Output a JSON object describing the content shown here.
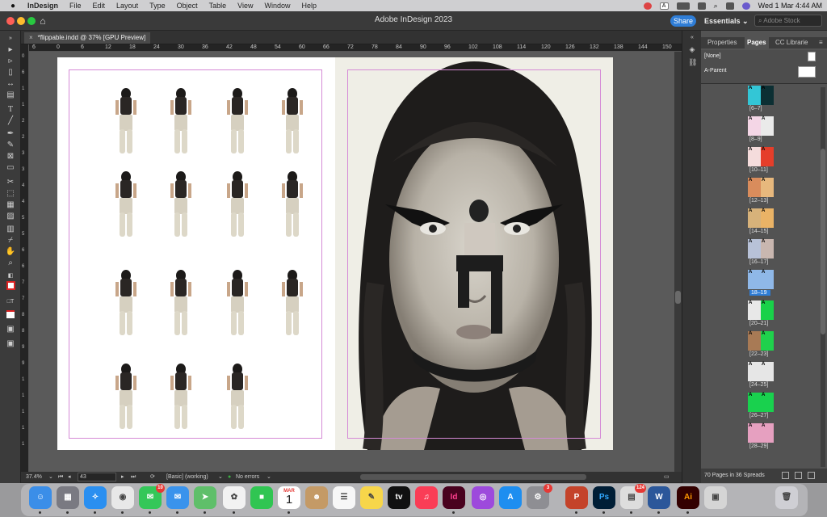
{
  "menubar": {
    "app_name": "InDesign",
    "items": [
      "File",
      "Edit",
      "Layout",
      "Type",
      "Object",
      "Table",
      "View",
      "Window",
      "Help"
    ],
    "datetime": "Wed 1 Mar  4:44 AM",
    "lang_badge": "A"
  },
  "titlebar": {
    "title": "Adobe InDesign 2023",
    "share_label": "Share",
    "workspace_label": "Essentials",
    "search_placeholder": "Adobe Stock"
  },
  "document": {
    "tab_label": "*flippable.indd @ 37% [GPU Preview]",
    "close_glyph": "×"
  },
  "ruler": {
    "h_ticks": [
      "6",
      "0",
      "6",
      "12",
      "18",
      "24",
      "30",
      "36",
      "42",
      "48",
      "54",
      "60",
      "66",
      "72",
      "78",
      "84",
      "90",
      "96",
      "102",
      "108",
      "114",
      "120",
      "126",
      "132",
      "138",
      "144",
      "150"
    ],
    "v_ticks": [
      "0",
      "6",
      "1",
      "1",
      "2",
      "2",
      "3",
      "3",
      "4",
      "4",
      "5",
      "5",
      "6",
      "6",
      "7",
      "7",
      "8",
      "8",
      "9",
      "9",
      "1",
      "1",
      "1",
      "1",
      "1"
    ]
  },
  "statusbar": {
    "zoom": "37.4%",
    "page_number": "43",
    "page_state": "[Basic] (working)",
    "preflight": "No errors"
  },
  "panel": {
    "tabs": [
      "Properties",
      "Pages",
      "CC Librarie"
    ],
    "active_tab": "Pages",
    "parents": [
      "[None]",
      "A-Parent"
    ],
    "spreads": [
      {
        "label": "[6–7]",
        "selected": false
      },
      {
        "label": "[8–9]",
        "selected": false
      },
      {
        "label": "[10–11]",
        "selected": false
      },
      {
        "label": "[12–13]",
        "selected": false
      },
      {
        "label": "[14–15]",
        "selected": false
      },
      {
        "label": "[16–17]",
        "selected": false
      },
      {
        "label": "18–19",
        "selected": true
      },
      {
        "label": "[20–21]",
        "selected": false
      },
      {
        "label": "[22–23]",
        "selected": false
      },
      {
        "label": "[24–25]",
        "selected": false
      },
      {
        "label": "[26–27]",
        "selected": false
      },
      {
        "label": "[28–29]",
        "selected": false
      }
    ],
    "page_letter": "A",
    "footer": "70 Pages in 36 Spreads"
  },
  "dock": {
    "calendar_month": "MAR",
    "calendar_day": "1",
    "messages_badge": "10",
    "settings_badge": "3",
    "printer_badge": "124",
    "apps": [
      "Finder",
      "Launchpad",
      "Safari",
      "Chrome",
      "Messages",
      "Mail",
      "Maps",
      "Photos",
      "FaceTime",
      "Calendar",
      "Contacts",
      "Reminders",
      "Notes",
      "TV",
      "Music",
      "InDesign",
      "Podcasts",
      "App Store",
      "System Settings",
      "PowerPoint",
      "Photoshop",
      "Printer",
      "Word",
      "Illustrator",
      "Preview",
      "Trash"
    ],
    "labels": {
      "tv": "tv",
      "indesign": "Id",
      "photoshop": "Ps",
      "illustrator": "Ai",
      "word": "W",
      "powerpoint": "P"
    }
  },
  "colors": {
    "accent": "#2f7dd6",
    "indesign": "#49021f",
    "margin_guide": "#d58ad6",
    "selected_spread": "#8fb8e8"
  }
}
